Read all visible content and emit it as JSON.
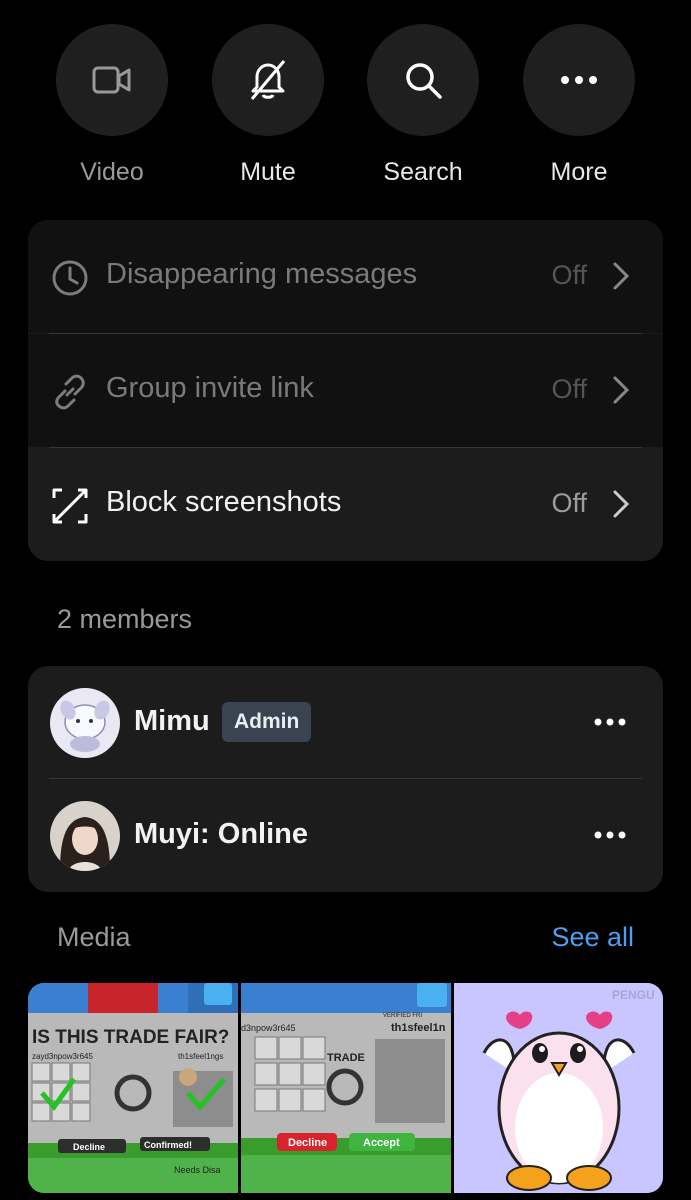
{
  "actions": [
    {
      "label": "Video",
      "icon": "video-icon",
      "enabled": false
    },
    {
      "label": "Mute",
      "icon": "mute-bell-icon",
      "enabled": true
    },
    {
      "label": "Search",
      "icon": "search-icon",
      "enabled": true
    },
    {
      "label": "More",
      "icon": "more-dots-icon",
      "enabled": true
    }
  ],
  "settings": [
    {
      "label": "Disappearing messages",
      "value": "Off",
      "icon": "clock-icon",
      "enabled": false
    },
    {
      "label": "Group invite link",
      "value": "Off",
      "icon": "link-icon",
      "enabled": false
    },
    {
      "label": "Block screenshots",
      "value": "Off",
      "icon": "block-screenshot-icon",
      "enabled": true
    }
  ],
  "members_count": "2 members",
  "members": [
    {
      "name": "Mimu",
      "badge": "Admin"
    },
    {
      "name": "Muyi: Online"
    }
  ],
  "media": {
    "title": "Media",
    "see_all": "See all",
    "thumbs": [
      {
        "texts": {
          "heading": "IS THIS TRADE FAIR?",
          "user1": "zayd3npow3r645",
          "user2": "th1sfeel1ngs",
          "decline": "Decline",
          "confirmed": "Confirmed!",
          "footer": "Needs Disa"
        }
      },
      {
        "texts": {
          "user1": "d3npow3r645",
          "verified": "VERIFIED FRI",
          "user2": "th1sfeel1n",
          "trade": "TRADE",
          "decline": "Decline",
          "accept": "Accept"
        }
      },
      {
        "texts": {
          "brand": "PENGU"
        }
      }
    ]
  },
  "colors": {
    "background": "#000000",
    "card": "#1c1c1c",
    "accent": "#4d9ff0",
    "badge": "#3a4450"
  }
}
